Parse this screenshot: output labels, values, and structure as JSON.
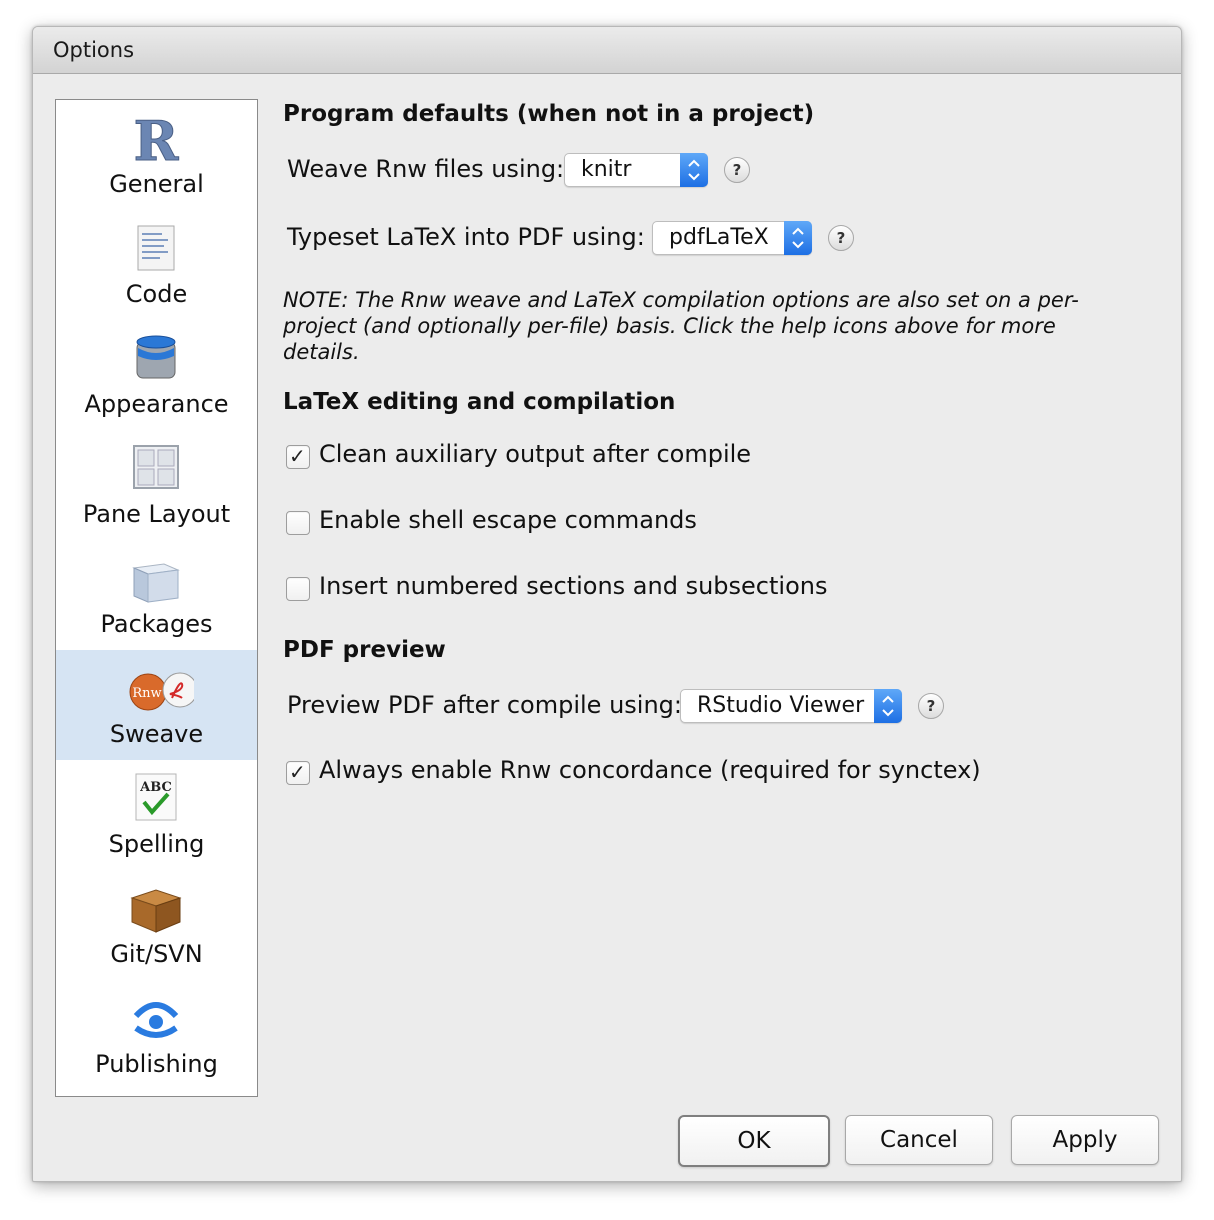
{
  "window": {
    "title": "Options"
  },
  "sidebar": {
    "items": [
      {
        "label": "General",
        "icon": "r-logo-icon",
        "selected": false
      },
      {
        "label": "Code",
        "icon": "code-document-icon",
        "selected": false
      },
      {
        "label": "Appearance",
        "icon": "paint-bucket-icon",
        "selected": false
      },
      {
        "label": "Pane Layout",
        "icon": "pane-grid-icon",
        "selected": false
      },
      {
        "label": "Packages",
        "icon": "package-cube-icon",
        "selected": false
      },
      {
        "label": "Sweave",
        "icon": "rnw-pdf-icon",
        "selected": true
      },
      {
        "label": "Spelling",
        "icon": "abc-check-icon",
        "selected": false
      },
      {
        "label": "Git/SVN",
        "icon": "box-icon",
        "selected": false
      },
      {
        "label": "Publishing",
        "icon": "publish-icon",
        "selected": false
      }
    ]
  },
  "sweave_icon_text": "Rnw",
  "spelling_icon_text": "ABC",
  "program_defaults": {
    "heading": "Program defaults (when not in a project)",
    "weave_label": "Weave Rnw files using:",
    "weave_value": "knitr",
    "typeset_label": "Typeset LaTeX into PDF using:",
    "typeset_value": "pdfLaTeX",
    "help_glyph": "?",
    "note": "NOTE: The Rnw weave and LaTeX compilation options are also set on a per-project (and optionally per-file) basis. Click the help icons above for more details."
  },
  "latex_editing": {
    "heading": "LaTeX editing and compilation",
    "options": [
      {
        "label": "Clean auxiliary output after compile",
        "checked": true
      },
      {
        "label": "Enable shell escape commands",
        "checked": false
      },
      {
        "label": "Insert numbered sections and subsections",
        "checked": false
      }
    ]
  },
  "pdf_preview": {
    "heading": "PDF preview",
    "preview_label": "Preview PDF after compile using:",
    "preview_value": "RStudio Viewer",
    "concordance_label": "Always enable Rnw concordance (required for synctex)",
    "concordance_checked": true
  },
  "buttons": {
    "ok": "OK",
    "cancel": "Cancel",
    "apply": "Apply"
  },
  "colors": {
    "accent": "#1d6fe4",
    "selected_bg": "#d6e4f3"
  }
}
